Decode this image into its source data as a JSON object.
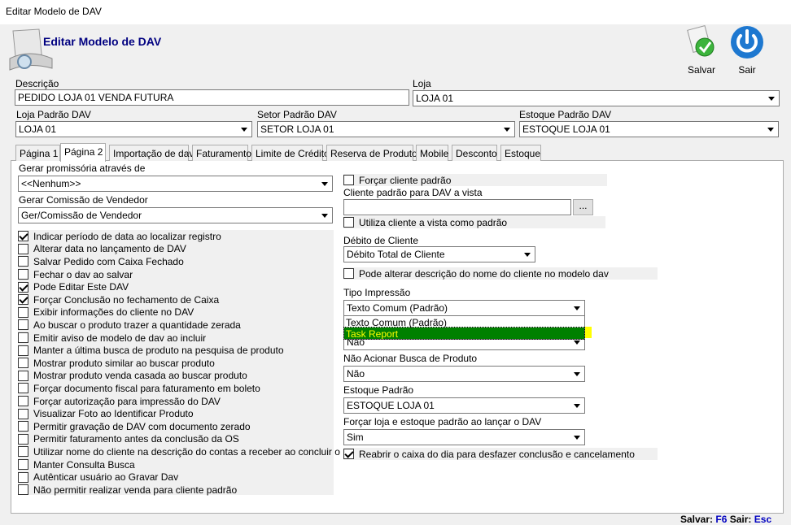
{
  "window": {
    "title": "Editar Modelo de DAV"
  },
  "header": {
    "title": "Editar Modelo de DAV"
  },
  "toolbar": {
    "save_label": "Salvar",
    "exit_label": "Sair"
  },
  "fields": {
    "descricao_label": "Descrição",
    "descricao_value": "PEDIDO LOJA 01 VENDA FUTURA",
    "loja_label": "Loja",
    "loja_value": "LOJA 01",
    "loja_padrao_label": "Loja Padrão DAV",
    "loja_padrao_value": "LOJA 01",
    "setor_padrao_label": "Setor Padrão DAV",
    "setor_padrao_value": "SETOR LOJA 01",
    "estoque_padrao_label": "Estoque Padrão DAV",
    "estoque_padrao_value": "ESTOQUE LOJA 01"
  },
  "tabs": [
    {
      "label": "Página 1"
    },
    {
      "label": "Página 2"
    },
    {
      "label": "Importação de dav"
    },
    {
      "label": "Faturamento"
    },
    {
      "label": "Limite de Crédito"
    },
    {
      "label": "Reserva de Produto"
    },
    {
      "label": "Mobile"
    },
    {
      "label": "Desconto"
    },
    {
      "label": "Estoque"
    }
  ],
  "left": {
    "promissoria_label": "Gerar promissória através de",
    "promissoria_value": "<<Nenhum>>",
    "comissao_label": "Gerar Comissão de Vendedor",
    "comissao_value": "Ger/Comissão de Vendedor",
    "checks": [
      {
        "label": "Indicar período de data ao localizar registro",
        "checked": true
      },
      {
        "label": "Alterar data no lançamento de DAV",
        "checked": false
      },
      {
        "label": "Salvar Pedido com Caixa Fechado",
        "checked": false
      },
      {
        "label": "Fechar o dav ao salvar",
        "checked": false
      },
      {
        "label": "Pode Editar Este DAV",
        "checked": true
      },
      {
        "label": "Forçar Conclusão no fechamento de Caixa",
        "checked": true
      },
      {
        "label": "Exibir informações do cliente no DAV",
        "checked": false
      },
      {
        "label": "Ao buscar o produto trazer a quantidade zerada",
        "checked": false
      },
      {
        "label": "Emitir aviso de modelo de dav ao incluir",
        "checked": false
      },
      {
        "label": "Manter a última busca de produto na pesquisa de produto",
        "checked": false
      },
      {
        "label": "Mostrar produto similar ao buscar produto",
        "checked": false
      },
      {
        "label": "Mostrar produto venda casada ao buscar produto",
        "checked": false
      },
      {
        "label": "Forçar documento fiscal para faturamento em boleto",
        "checked": false
      },
      {
        "label": "Forçar autorização para impressão do DAV",
        "checked": false
      },
      {
        "label": "Visualizar Foto ao Identificar Produto",
        "checked": false
      },
      {
        "label": "Permitir gravação de DAV com documento zerado",
        "checked": false
      },
      {
        "label": "Permitir faturamento antes da conclusão da OS",
        "checked": false
      },
      {
        "label": "Utilizar nome do cliente na descrição do contas a receber ao concluir o Dav",
        "checked": false
      },
      {
        "label": "Manter Consulta Busca",
        "checked": false
      },
      {
        "label": "Autênticar usuário ao Gravar Dav",
        "checked": false
      },
      {
        "label": "Não permitir realizar venda para cliente padrão",
        "checked": false
      }
    ]
  },
  "right": {
    "forcar_cliente_label": "Forçar cliente padrão",
    "cliente_padrao_label": "Cliente padrão para DAV a vista",
    "cliente_padrao_value": "",
    "browse_label": "...",
    "utiliza_cliente_label": "Utiliza cliente a vista como padrão",
    "debito_label": "Débito de Cliente",
    "debito_value": "Débito Total de Cliente",
    "alterar_desc_label": "Pode alterar descrição do nome do cliente no modelo dav",
    "tipo_impressao_label": "Tipo Impressão",
    "tipo_impressao_value": "Texto Comum (Padrão)",
    "tipo_impressao_options": [
      "Texto Comum (Padrão)",
      "Task Report"
    ],
    "hidden_combo_value": "Não",
    "nao_acionar_label": "Não Acionar Busca de Produto",
    "nao_acionar_value": "Não",
    "estoque_padrao_label": "Estoque Padrão",
    "estoque_padrao_value": "ESTOQUE LOJA 01",
    "forcar_loja_label": "Forçar loja e estoque padrão ao lançar o DAV",
    "forcar_loja_value": "Sim",
    "reabrir_label": "Reabrir o caixa do dia para desfazer conclusão e cancelamento"
  },
  "status": {
    "save_text": "Salvar:",
    "save_key": "F6",
    "exit_text": "Sair:",
    "exit_key": "Esc"
  }
}
